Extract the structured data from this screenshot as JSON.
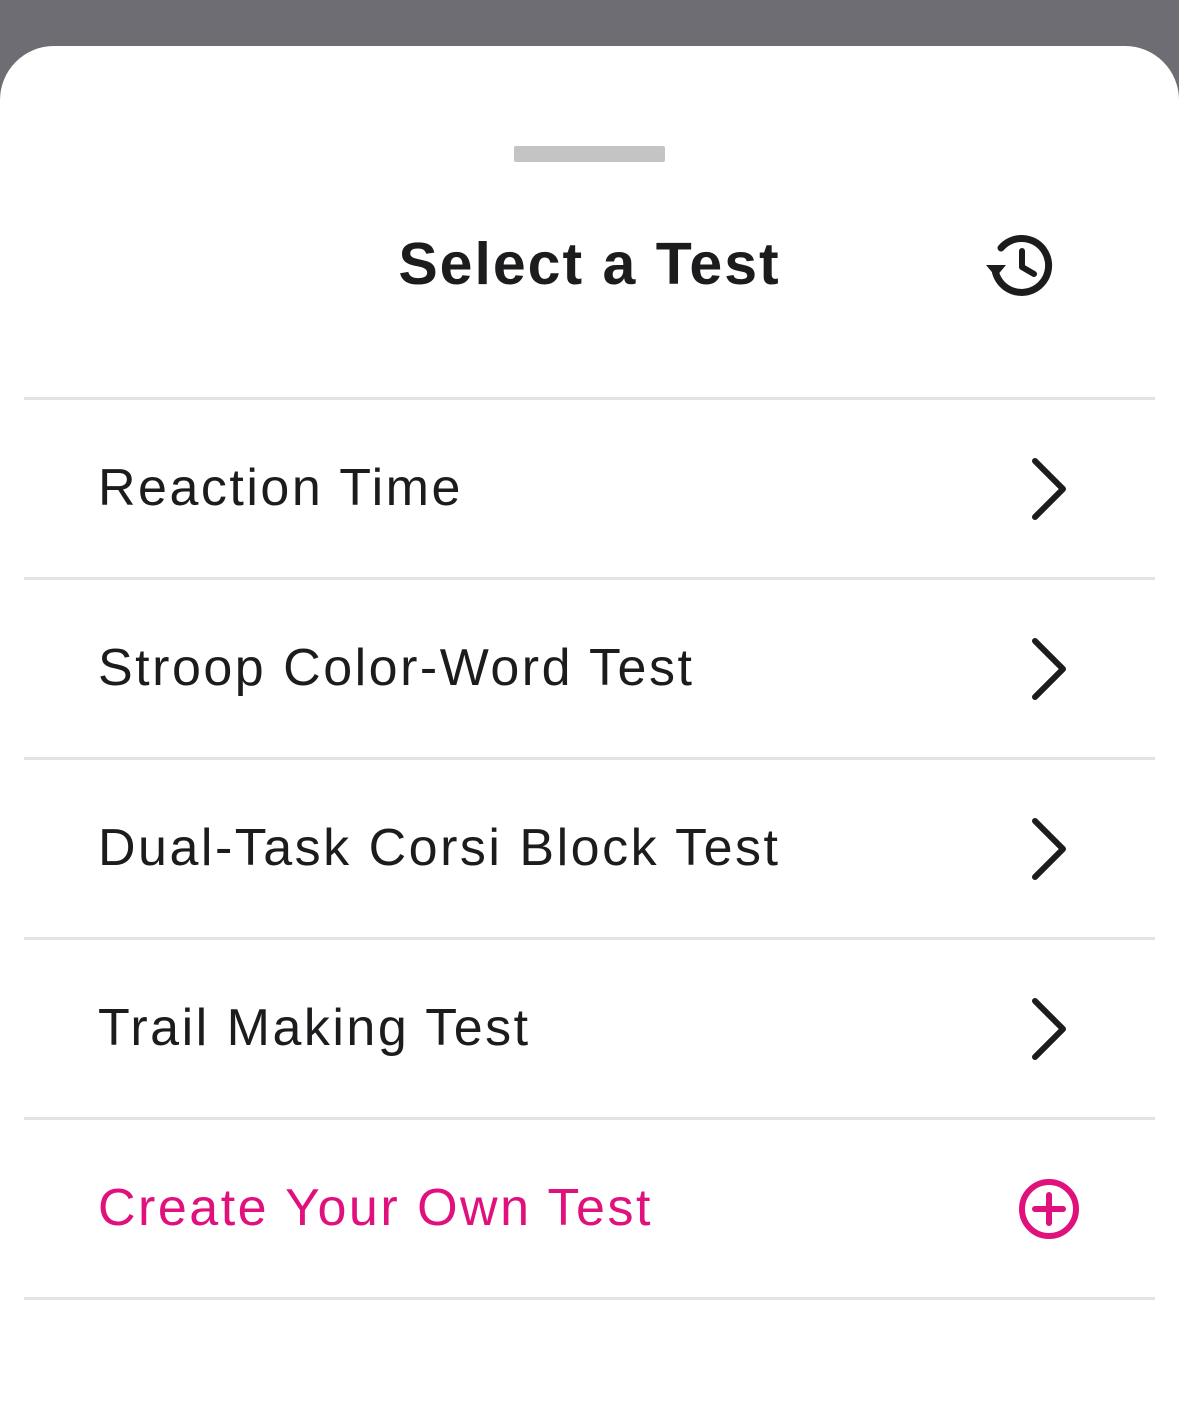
{
  "sheet": {
    "title": "Select a Test",
    "history_icon": "history-icon"
  },
  "tests": [
    {
      "label": "Reaction Time",
      "icon": "chevron-right-icon"
    },
    {
      "label": "Stroop Color-Word Test",
      "icon": "chevron-right-icon"
    },
    {
      "label": "Dual-Task Corsi Block Test",
      "icon": "chevron-right-icon"
    },
    {
      "label": "Trail Making Test",
      "icon": "chevron-right-icon"
    }
  ],
  "create": {
    "label": "Create Your Own Test",
    "icon": "plus-circle-icon"
  },
  "colors": {
    "accent": "#e0107c",
    "text": "#1c1c1e",
    "backdrop": "#6f6d74",
    "divider": "#e3e3e3"
  }
}
